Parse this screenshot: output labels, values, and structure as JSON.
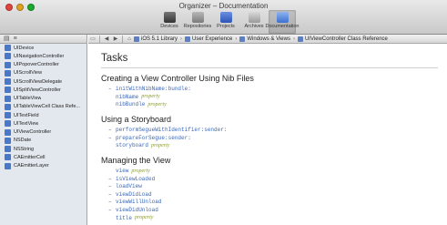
{
  "window": {
    "title": "Organizer – Documentation",
    "toolbar": [
      {
        "label": "Devices",
        "icon": "devices-icon",
        "selected": false
      },
      {
        "label": "Repositories",
        "icon": "repositories-icon",
        "selected": false
      },
      {
        "label": "Projects",
        "icon": "projects-icon",
        "selected": false
      },
      {
        "label": "Archives",
        "icon": "archives-icon",
        "selected": false
      },
      {
        "label": "Documentation",
        "icon": "documentation-icon",
        "selected": true
      }
    ]
  },
  "sidebar": {
    "items": [
      "UIDevice",
      "UINavigationController",
      "UIPopoverController",
      "UIScrollView",
      "UIScrollViewDelegate",
      "UISplitViewController",
      "UITableView",
      "UITableViewCell Class Refe...",
      "UITextField",
      "UITextView",
      "UIViewController",
      "NSDate",
      "NSString",
      "CAEmitterCell",
      "CAEmitterLayer"
    ]
  },
  "breadcrumbs": [
    "iOS 5.1 Library",
    "User Experience",
    "Windows & Views",
    "UIViewController Class Reference"
  ],
  "content": {
    "title": "Tasks",
    "sections": [
      {
        "heading": "Creating a View Controller Using Nib Files",
        "members": [
          {
            "dash": "–",
            "name": "initWithNibName:bundle:",
            "kind": ""
          },
          {
            "dash": "",
            "name": "nibName",
            "kind": "property"
          },
          {
            "dash": "",
            "name": "nibBundle",
            "kind": "property"
          }
        ]
      },
      {
        "heading": "Using a Storyboard",
        "members": [
          {
            "dash": "–",
            "name": "performSegueWithIdentifier:sender:",
            "kind": ""
          },
          {
            "dash": "–",
            "name": "prepareForSegue:sender:",
            "kind": ""
          },
          {
            "dash": "",
            "name": "storyboard",
            "kind": "property"
          }
        ]
      },
      {
        "heading": "Managing the View",
        "members": [
          {
            "dash": "",
            "name": "view",
            "kind": "property"
          },
          {
            "dash": "–",
            "name": "isViewLoaded",
            "kind": ""
          },
          {
            "dash": "–",
            "name": "loadView",
            "kind": ""
          },
          {
            "dash": "–",
            "name": "viewDidLoad",
            "kind": ""
          },
          {
            "dash": "–",
            "name": "viewWillUnload",
            "kind": ""
          },
          {
            "dash": "–",
            "name": "viewDidUnload",
            "kind": ""
          },
          {
            "dash": "",
            "name": "title",
            "kind": "property"
          }
        ]
      }
    ]
  },
  "colors": {
    "link": "#3a67b5",
    "property": "#8a9a2c",
    "sidebar_bg": "#e3e8ee"
  }
}
